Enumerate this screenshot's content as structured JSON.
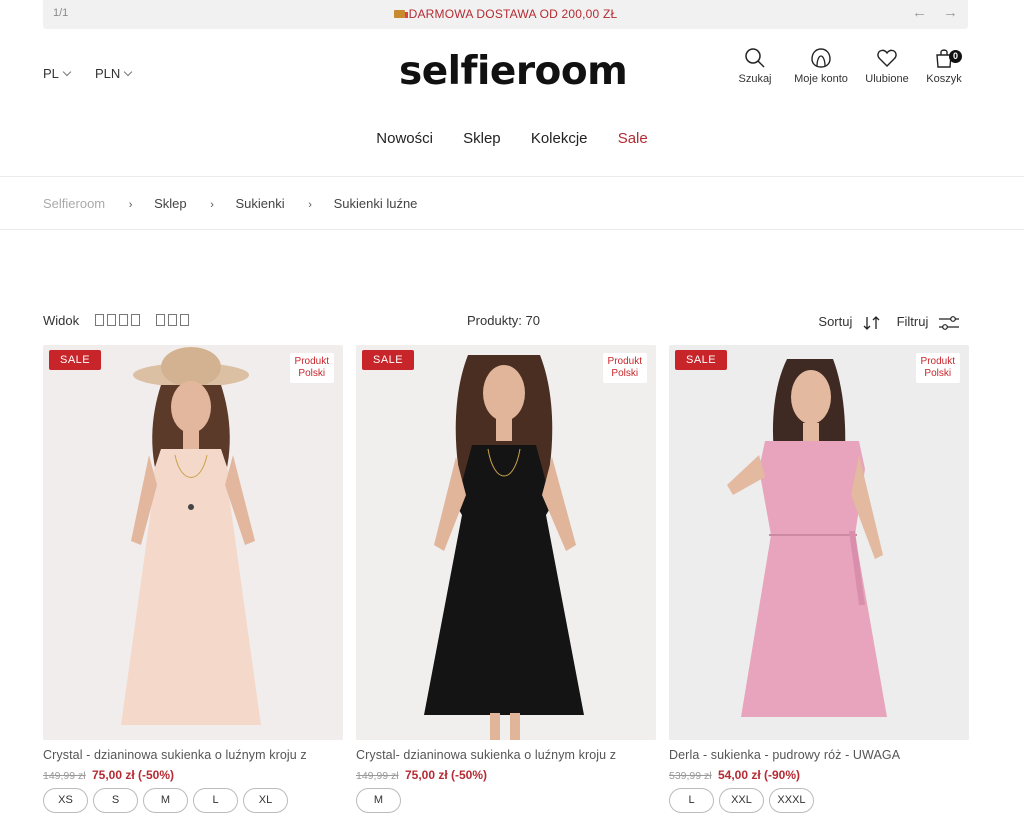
{
  "topbar": {
    "counter": "1/1",
    "promo": "DARMOWA DOSTAWA OD 200,00 ZŁ",
    "prev_arrow": "←",
    "next_arrow": "→",
    "promo_color": "#b52b33"
  },
  "header": {
    "language": "PL",
    "currency": "PLN",
    "logo": "selfieroom",
    "icons": [
      {
        "icon": "search-icon",
        "label": "Szukaj"
      },
      {
        "icon": "account-icon",
        "label": "Moje konto"
      },
      {
        "icon": "heart-icon",
        "label": "Ulubione"
      },
      {
        "icon": "cart-icon",
        "label": "Koszyk",
        "badge": "0"
      }
    ]
  },
  "nav": {
    "items": [
      "Nowości",
      "Sklep",
      "Kolekcje",
      "Sale"
    ],
    "sale_color": "#b52b33"
  },
  "breadcrumb": [
    "Selfieroom",
    "Sklep",
    "Sukienki",
    "Sukienki luźne"
  ],
  "breadcrumb_separator": "›",
  "toolbar": {
    "view_label": "Widok",
    "products_count": "Produkty: 70",
    "sort_label": "Sortuj",
    "filter_label": "Filtruj"
  },
  "products": [
    {
      "sale_badge": "SALE",
      "origin_badge_line1": "Produkt",
      "origin_badge_line2": "Polski",
      "dress_color": "#f4d9cb",
      "name": "Crystal - dzianinowa sukienka o luźnym kroju z",
      "old_price": "149,99 zł",
      "new_price": "75,00 zł (-50%)",
      "sizes": [
        "XS",
        "S",
        "M",
        "L",
        "XL"
      ]
    },
    {
      "sale_badge": "SALE",
      "origin_badge_line1": "Produkt",
      "origin_badge_line2": "Polski",
      "dress_color": "#141414",
      "name": "Crystal- dzianinowa sukienka o luźnym kroju z",
      "old_price": "149,99 zł",
      "new_price": "75,00 zł (-50%)",
      "sizes": [
        "M"
      ]
    },
    {
      "sale_badge": "SALE",
      "origin_badge_line1": "Produkt",
      "origin_badge_line2": "Polski",
      "dress_color": "#e7a4bc",
      "name": "Derla - sukienka - pudrowy róż - UWAGA",
      "old_price": "539,99 zł",
      "new_price": "54,00 zł (-90%)",
      "sizes": [
        "L",
        "XXL",
        "XXXL"
      ]
    }
  ]
}
